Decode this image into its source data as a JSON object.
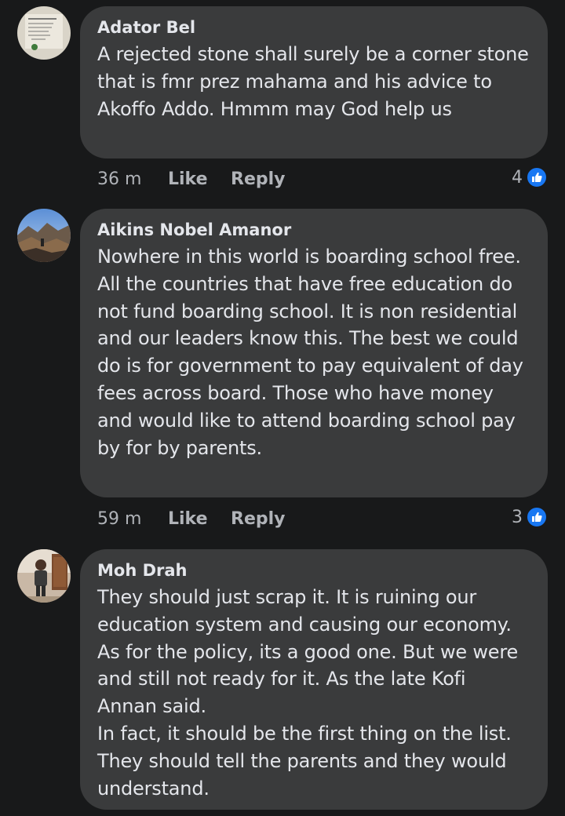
{
  "colors": {
    "background": "#18191a",
    "bubble": "#3a3b3c",
    "text": "#e4e6eb",
    "secondary_text": "#b0b3b8",
    "like_blue": "#1877f2"
  },
  "comments": [
    {
      "author": "Adator Bel",
      "text": "A rejected stone shall surely be a corner stone that is fmr prez mahama and his advice to Akoffo Addo. Hmmm may God help us",
      "time": "36 m",
      "like_label": "Like",
      "reply_label": "Reply",
      "reaction_count": "4",
      "reaction_icon": "thumbs-up-icon"
    },
    {
      "author": "Aikins Nobel Amanor",
      "text": "Nowhere in this world is boarding school free. All the countries that have free education do not fund boarding school. It is non residential and our leaders know this. The best we could do is for government to pay equivalent of day fees across board. Those who have money and would like to attend boarding school pay by for by parents.",
      "time": "59 m",
      "like_label": "Like",
      "reply_label": "Reply",
      "reaction_count": "3",
      "reaction_icon": "thumbs-up-icon"
    },
    {
      "author": "Moh Drah",
      "text": "They should just scrap it. It is ruining our education system and causing our economy. As for the policy, its a good one. But we were and still not ready for it. As the late Kofi Annan said.\nIn fact, it should be the first thing on the list. They should tell the parents and they would understand."
    }
  ]
}
